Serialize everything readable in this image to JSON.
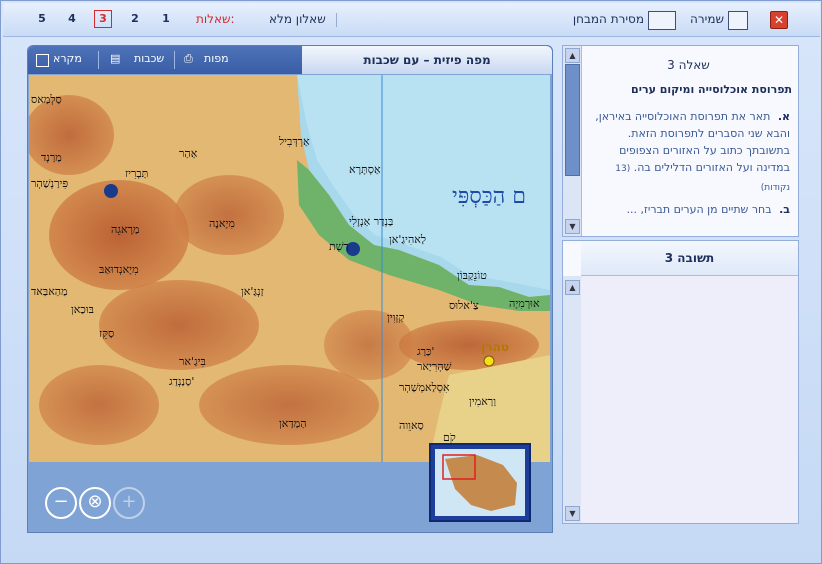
{
  "toolbar": {
    "save_label": "שמירה",
    "submit_label": "מסירת המבחן",
    "full_questionnaire_label": "שאלון מלא",
    "questions_label": "שאלות:",
    "question_numbers": [
      "1",
      "2",
      "3",
      "4",
      "5"
    ],
    "active_question": "3"
  },
  "map_panel": {
    "title": "מפה פיזית – עם שכבות",
    "tabs": {
      "maps": "מפות",
      "layers": "שכבות",
      "legend": "מקרא"
    },
    "caspian_label": "ם הַכַּסְפִּי",
    "tehran_label": "טהרן",
    "places": [
      "אַרְדְּבִיל",
      "אַסְתָּרָא",
      "בַּנְדַר אַנְזָלִי",
      "רַשְׁת",
      "לַאהִיגַ'אן",
      "תַּבְרִיז",
      "מַרַנְד",
      "אַהַר",
      "מַרָאגֵה",
      "מִיָאנֶה",
      "מַהַאבַּאד",
      "זַנְגַּ'אן",
      "קַזְוִין",
      "בּוּכַאן",
      "סַקֵּז",
      "בִּיגַ'אר",
      "סַנַנְדַג'",
      "הַמַדַאן",
      "סַאוֵוה",
      "קֹם",
      "כַּרַג'",
      "שַׁהְרִיַאר",
      "טוֹנֵקַבּוֹן",
      "צַ'אלוּס",
      "אִסְלַאמְשַׁהְר",
      "וַרַאמִין",
      "פִּירַנְשַׁהְר",
      "מִיָאנְדוּאַבּ",
      "סַלְמַאס",
      "אוּרְמִיָה"
    ]
  },
  "question": {
    "header": "שאלה 3",
    "subtitle": "תפרוסת אוכלוסייה ומיקום ערים",
    "a_letter": "א.",
    "a_text": "תאר את תפרוסת האוכלוסייה באיראן, והבא שני הסברים לתפרוסת הזאת. בתשובתך כתוב על האזורים הצפופים במדינה ועל האזורים הדלילים בה.",
    "a_points": "(13 נקודות)",
    "b_letter": "ב.",
    "b_text": "בחר שתיים מן הערים תבריז, ..."
  },
  "answer": {
    "header": "תשובה 3",
    "text": ""
  }
}
